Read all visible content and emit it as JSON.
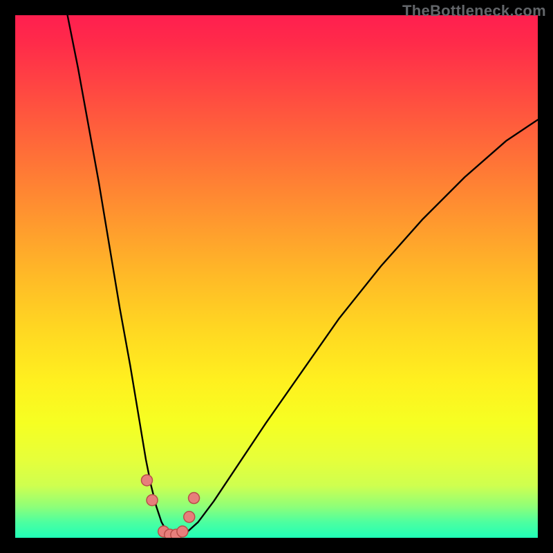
{
  "watermark": "TheBottleneck.com",
  "chart_data": {
    "type": "line",
    "title": "",
    "xlabel": "",
    "ylabel": "",
    "xlim": [
      0,
      100
    ],
    "ylim": [
      0,
      100
    ],
    "grid": false,
    "background_gradient_vertical": [
      {
        "pct": 0,
        "color": "#ff1f4f"
      },
      {
        "pct": 50,
        "color": "#ffd722"
      },
      {
        "pct": 78,
        "color": "#f6ff22"
      },
      {
        "pct": 100,
        "color": "#20ffb7"
      }
    ],
    "series": [
      {
        "name": "bottleneck-curve",
        "stroke": "#000000",
        "stroke_width": 2.4,
        "x": [
          10,
          12,
          14,
          16,
          18,
          20,
          22,
          24,
          25,
          26,
          27,
          28,
          29,
          30,
          31,
          32,
          33,
          35,
          38,
          42,
          48,
          55,
          62,
          70,
          78,
          86,
          94,
          100
        ],
        "values": [
          100,
          90,
          79,
          68,
          56,
          44,
          33,
          21,
          15,
          10,
          6,
          3,
          1.2,
          0.5,
          0.3,
          0.5,
          1.2,
          3,
          7,
          13,
          22,
          32,
          42,
          52,
          61,
          69,
          76,
          80
        ]
      }
    ],
    "markers": {
      "name": "highlighted-points",
      "fill": "#e77e7b",
      "stroke": "#b74e49",
      "radius_px": 8,
      "x": [
        25.2,
        26.2,
        28.4,
        29.6,
        30.8,
        32.0,
        33.3,
        34.2
      ],
      "values": [
        11.0,
        7.2,
        1.2,
        0.6,
        0.6,
        1.2,
        4.0,
        7.6
      ]
    }
  }
}
